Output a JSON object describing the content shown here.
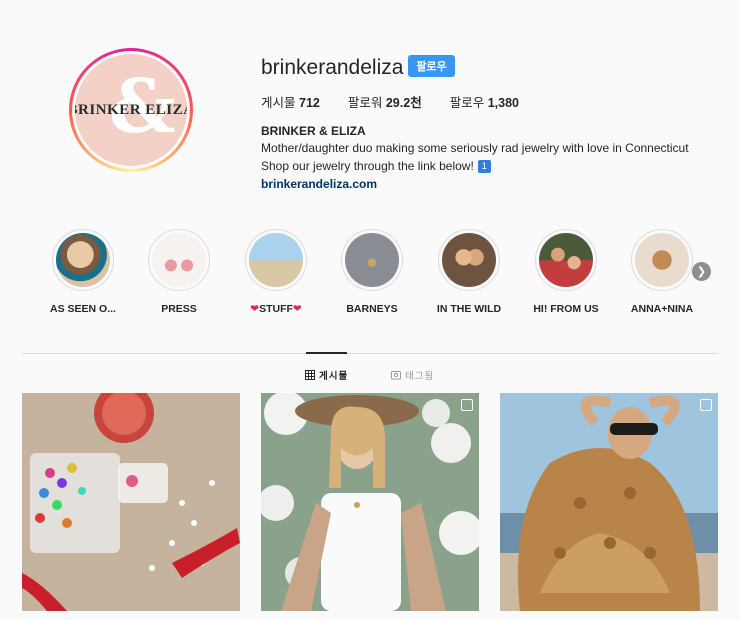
{
  "profile": {
    "username": "brinkerandeliza",
    "follow_label": "팔로우",
    "avatar_text": "BRINKER  ELIZA",
    "avatar_amp": "&",
    "stats": {
      "posts_label": "게시물",
      "posts_value": "712",
      "followers_label": "팔로워",
      "followers_value": "29.2천",
      "following_label": "팔로우",
      "following_value": "1,380"
    },
    "bio_name": "BRINKER & ELIZA",
    "bio_line1": "Mother/daughter duo making some seriously rad jewelry with love in Connecticut",
    "bio_line2": "Shop our jewelry through the link below!",
    "bio_badge": "1",
    "bio_link": "brinkerandeliza.com"
  },
  "highlights": [
    {
      "label": "AS SEEN O..."
    },
    {
      "label": "PRESS"
    },
    {
      "label_prefix": "❤",
      "label": "STUFF",
      "label_suffix": "❤"
    },
    {
      "label": "BARNEYS"
    },
    {
      "label": "IN THE WILD"
    },
    {
      "label": "HI! FROM US"
    },
    {
      "label": "ANNA+NINA"
    }
  ],
  "tabs": {
    "posts_label": "게시물",
    "tagged_label": "태그됨"
  },
  "icons": [
    "chevron-right-icon",
    "grid-icon",
    "tag-icon",
    "multi-post-icon"
  ],
  "colors": {
    "follow_button": "#3897f0",
    "link": "#003569",
    "heart": "#e0245e"
  }
}
